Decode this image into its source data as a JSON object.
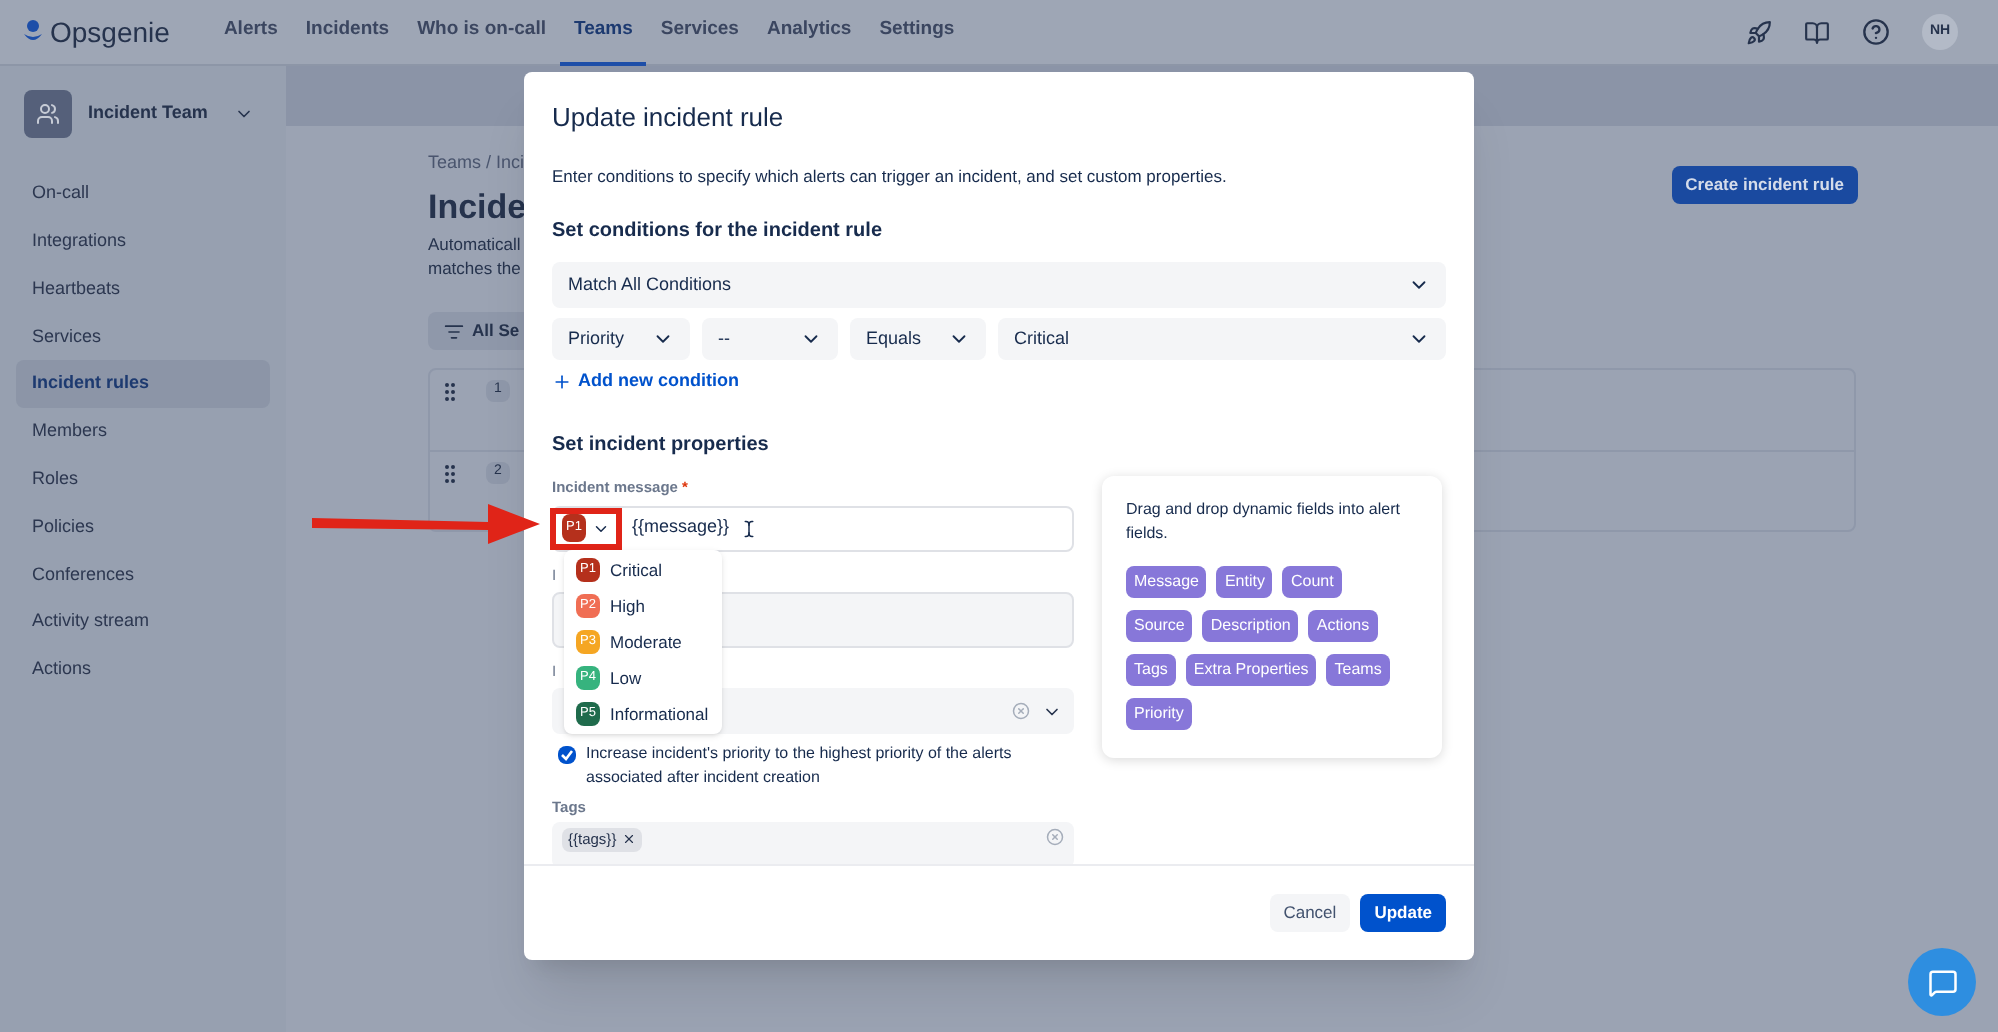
{
  "nav": {
    "brand": "Opsgenie",
    "items": [
      {
        "label": "Alerts",
        "selected": false
      },
      {
        "label": "Incidents",
        "selected": false
      },
      {
        "label": "Who is on-call",
        "selected": false
      },
      {
        "label": "Teams",
        "selected": true
      },
      {
        "label": "Services",
        "selected": false
      },
      {
        "label": "Analytics",
        "selected": false
      },
      {
        "label": "Settings",
        "selected": false
      }
    ],
    "avatar": "NH"
  },
  "sidebar": {
    "team": "Incident Team",
    "items": [
      {
        "label": "On-call",
        "selected": false
      },
      {
        "label": "Integrations",
        "selected": false
      },
      {
        "label": "Heartbeats",
        "selected": false
      },
      {
        "label": "Services",
        "selected": false
      },
      {
        "label": "Incident rules",
        "selected": true
      },
      {
        "label": "Members",
        "selected": false
      },
      {
        "label": "Roles",
        "selected": false
      },
      {
        "label": "Policies",
        "selected": false
      },
      {
        "label": "Conferences",
        "selected": false
      },
      {
        "label": "Activity stream",
        "selected": false
      },
      {
        "label": "Actions",
        "selected": false
      }
    ]
  },
  "page": {
    "breadcrumb": "Teams / Inci",
    "title": "Incide",
    "description": [
      "Automaticall",
      "matches the"
    ],
    "filter": "All Se",
    "rows": [
      "1",
      "2"
    ],
    "create_button": "Create incident rule"
  },
  "modal": {
    "title": "Update incident rule",
    "intro": "Enter conditions to specify which alerts can trigger an incident, and set custom properties.",
    "conditions_heading": "Set conditions for the incident rule",
    "match": "Match All Conditions",
    "condition": [
      "Priority",
      "--",
      "Equals",
      "Critical"
    ],
    "add_condition": "Add new condition",
    "properties_heading": "Set incident properties",
    "message_label": "Incident message",
    "required_mark": "*",
    "priority_badge": {
      "label": "P1",
      "color": "#b5301c"
    },
    "message": "{{message}}",
    "priority_menu": [
      {
        "badge": "P1",
        "label": "Critical",
        "color": "#b5301c"
      },
      {
        "badge": "P2",
        "label": "High",
        "color": "#f06e54"
      },
      {
        "badge": "P3",
        "label": "Moderate",
        "color": "#f5a623"
      },
      {
        "badge": "P4",
        "label": "Low",
        "color": "#36b37e"
      },
      {
        "badge": "P5",
        "label": "Informational",
        "color": "#1f6b4c"
      }
    ],
    "cut_labels": [
      "I",
      "I"
    ],
    "checkbox": {
      "checked": true,
      "label": "Increase incident's priority to the highest priority of the alerts associated after incident creation"
    },
    "tags_label": "Tags",
    "tags": [
      "{{tags}}"
    ],
    "help": {
      "text": "Drag and drop dynamic fields into alert fields.",
      "fields": [
        "Message",
        "Entity",
        "Count",
        "Source",
        "Description",
        "Actions",
        "Tags",
        "Extra Properties",
        "Teams",
        "Priority"
      ]
    },
    "buttons": {
      "cancel": "Cancel",
      "update": "Update"
    }
  }
}
